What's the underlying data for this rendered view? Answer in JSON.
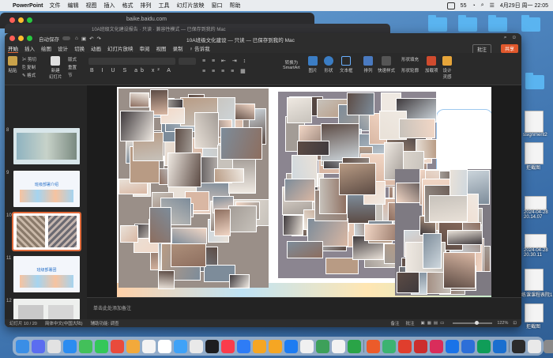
{
  "menubar": {
    "app": "PowerPoint",
    "items": [
      "文件",
      "编辑",
      "视图",
      "插入",
      "格式",
      "排列",
      "工具",
      "幻灯片放映",
      "窗口",
      "帮助"
    ],
    "battery": "55",
    "datetime": "4月29日 周一  22:05"
  },
  "browser": {
    "url": "baike.baidu.com",
    "tab_title": "10A班级文化建设报告 · 只读 · 兼容性模式 — 已保存到我的 Mac"
  },
  "ppt": {
    "autosave": "自动保存",
    "title": "10A班级文化建设 — 只读 — 已保存到我的 Mac",
    "tabs": [
      "开始",
      "插入",
      "绘图",
      "设计",
      "切换",
      "动画",
      "幻灯片放映",
      "审阅",
      "视图",
      "录制",
      "♀ 告诉我"
    ],
    "active_tab": "开始",
    "comment_btn": "批注",
    "share_btn": "共享",
    "ribbon": {
      "paste": "粘贴",
      "cut": "剪切",
      "copy": "复制",
      "format": "格式",
      "new_slide": "新建\n幻灯片",
      "layout": "版式",
      "reset": "重置",
      "section": "节",
      "smartart": "转换为\nSmartArt",
      "picture": "图片",
      "shape": "形状",
      "textbox": "文本框",
      "arrange": "排列",
      "quick_styles": "快速样式",
      "shape_fill": "形状填充",
      "shape_outline": "形状轮廓",
      "addins": "加载项",
      "designer": "设计\n灵感"
    },
    "thumb_numbers": [
      "8",
      "9",
      "10",
      "11",
      "12",
      "13"
    ],
    "thumb9_title": "班级部署介绍",
    "thumb11_title": "班级部署团",
    "notes_placeholder": "单击此处添加备注",
    "status": {
      "slide": "幻灯片 10 / 20",
      "lang": "简体中文(中国大陆)",
      "access": "辅助功能: 调查",
      "notes": "备注",
      "comments": "批注",
      "zoom": "122%"
    }
  },
  "desktop": {
    "labels": [
      "ssignment2",
      "拒截图",
      "2024-04-28\n20.14.07",
      "2024-04-28\n20.30.11",
      "演练课课程表院1..11",
      "拒截图"
    ]
  },
  "colors": {
    "accent": "#e0582c",
    "selected_thumb": "#e06a3a"
  }
}
